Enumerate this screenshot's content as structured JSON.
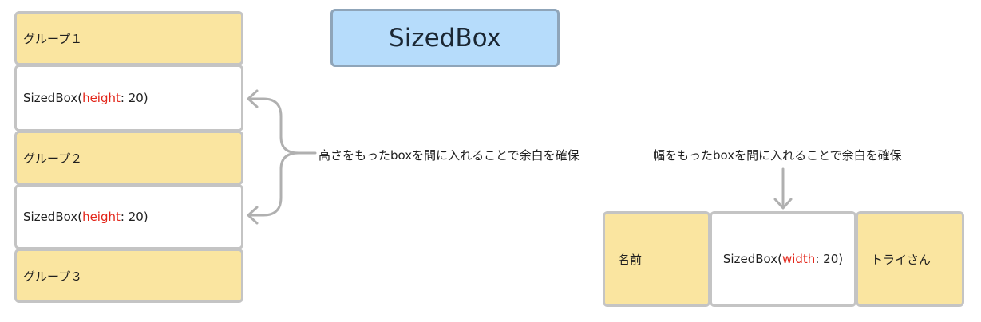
{
  "title": "SizedBox",
  "vertical_column": {
    "group1": "グループ１",
    "spacer1": {
      "name": "SizedBox(",
      "param": "height",
      "rest": ": 20)"
    },
    "group2": "グループ２",
    "spacer2": {
      "name": "SizedBox(",
      "param": "height",
      "rest": ": 20)"
    },
    "group3": "グループ３"
  },
  "vertical_note": "高さをもったboxを間に入れることで余白を確保",
  "horizontal_row": {
    "item1": "名前",
    "spacer": {
      "name": "SizedBox(",
      "param": "width",
      "rest": ": 20)"
    },
    "item2": "トライさん"
  },
  "horizontal_note": "幅をもったboxを間に入れることで余白を確保",
  "colors": {
    "group_fill": "#fae5a0",
    "border": "#c4c4c4",
    "title_fill": "#b6dcfb",
    "param_highlight": "#e3261a",
    "arrow": "#b0b0b0"
  }
}
